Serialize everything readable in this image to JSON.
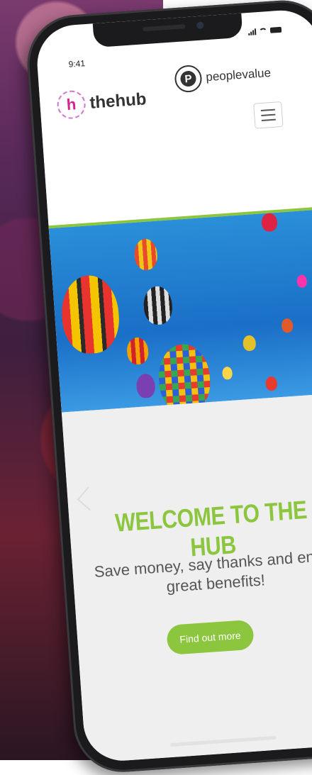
{
  "status": {
    "time": "9:41"
  },
  "header": {
    "brand_name": "thehub",
    "brand_letter": "h",
    "partner_name": "peoplevalue",
    "partner_letter": "P",
    "menu_icon": "hamburger-icon"
  },
  "welcome": {
    "title": "WELCOME TO THE HUB",
    "subtitle": "Save money, say thanks and enjoy great benefits!",
    "cta_label": "Find out more"
  },
  "colors": {
    "accent": "#8cc63f",
    "brand_pink": "#d6228e",
    "sky": "#1a6fc7"
  }
}
